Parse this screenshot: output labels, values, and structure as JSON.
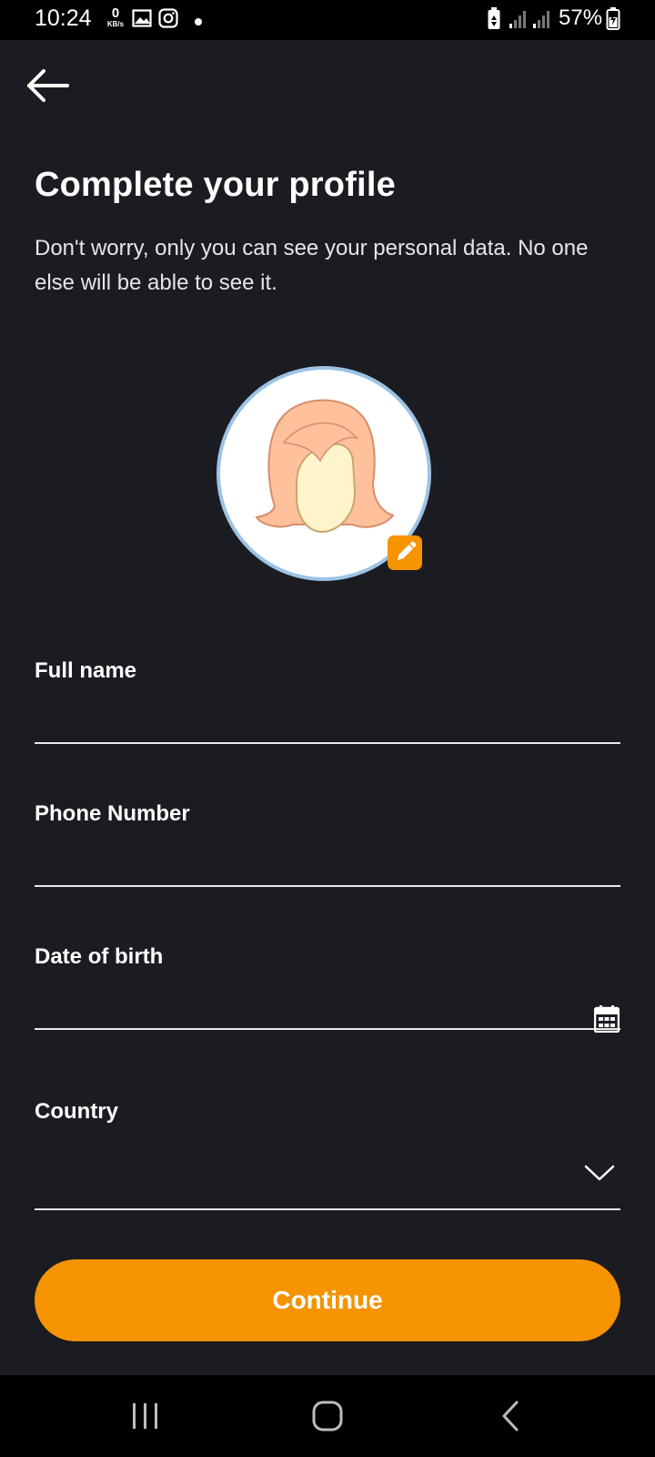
{
  "status_bar": {
    "time": "10:24",
    "data_rate_value": "0",
    "data_rate_unit": "KB/s",
    "battery_percent": "57%",
    "icons": [
      "gallery-icon",
      "instagram-icon",
      "notification-dot-icon",
      "battery-saver-icon",
      "signal-icon",
      "signal-icon",
      "battery-icon"
    ]
  },
  "header": {
    "back_icon": "arrow-left-icon"
  },
  "main": {
    "title": "Complete your profile",
    "subtitle": "Don't worry, only you can see your personal data. No one else will be able to see it.",
    "avatar": {
      "edit_icon": "pencil-icon"
    },
    "fields": {
      "full_name": {
        "label": "Full name",
        "value": "",
        "placeholder": ""
      },
      "phone": {
        "label": "Phone Number",
        "value": "",
        "placeholder": ""
      },
      "dob": {
        "label": "Date of birth",
        "value": "",
        "placeholder": "",
        "icon": "calendar-icon"
      },
      "country": {
        "label": "Country",
        "value": "",
        "placeholder": "",
        "icon": "chevron-down-icon"
      }
    },
    "continue_label": "Continue"
  },
  "nav_bar": {
    "icons": [
      "recent-apps-icon",
      "home-icon",
      "back-icon"
    ]
  },
  "colors": {
    "background": "#1b1c21",
    "accent": "#f59300",
    "text": "#ffffff",
    "avatar_ring": "#9cc3e4"
  }
}
